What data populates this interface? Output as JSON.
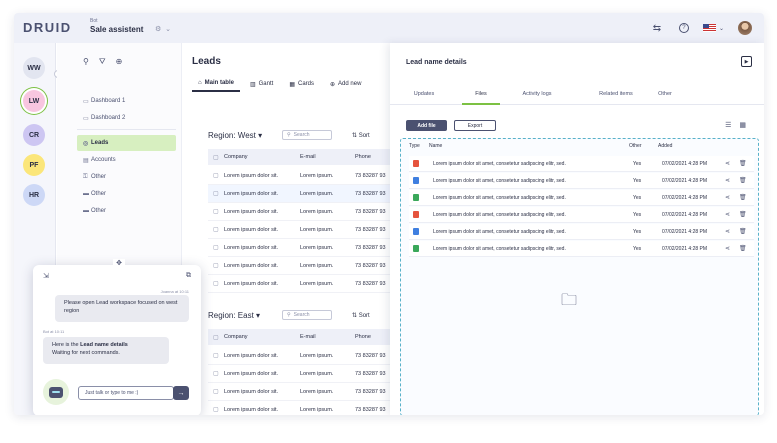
{
  "app": {
    "logo": "DRUID",
    "context_small": "Bot",
    "context_title": "Sale assistent",
    "settings_icon": "gear-icon"
  },
  "topbar": {
    "icons": [
      "handshake-icon",
      "help-icon",
      "flag-us-icon",
      "avatar"
    ]
  },
  "rail": {
    "items": [
      {
        "initials": "WW",
        "color": "#e2e5f0"
      },
      {
        "initials": "LW",
        "color": "#f8c6e0"
      },
      {
        "initials": "CR",
        "color": "#cdc6f2"
      },
      {
        "initials": "PF",
        "color": "#fbe67a"
      },
      {
        "initials": "HR",
        "color": "#cdd8f6"
      }
    ]
  },
  "sidebar": {
    "items": [
      {
        "label": "Dashboard 1",
        "icon": "dashboard-icon"
      },
      {
        "label": "Dashboard 2",
        "icon": "dashboard-icon"
      },
      {
        "label": "Leads",
        "icon": "target-icon",
        "active": true
      },
      {
        "label": "Accounts",
        "icon": "accounts-icon"
      },
      {
        "label": "Other",
        "icon": "key-icon"
      },
      {
        "label": "Other",
        "icon": "folder-icon"
      },
      {
        "label": "Other",
        "icon": "folder-icon"
      }
    ]
  },
  "leads": {
    "title": "Leads",
    "tabs": [
      "Main table",
      "Gantt",
      "Cards",
      "Add new"
    ],
    "search_placeholder": "Search",
    "sort_label": "Sort",
    "columns": [
      "Company",
      "E-mail",
      "Phone"
    ],
    "regions": [
      {
        "title": "Region: West",
        "rows": [
          [
            "Lorem ipsum dolor sit.",
            "Lorem ipsum.",
            "73 83287 93"
          ],
          [
            "Lorem ipsum dolor sit.",
            "Lorem ipsum.",
            "73 83287 93"
          ],
          [
            "Lorem ipsum dolor sit.",
            "Lorem ipsum.",
            "73 83287 93"
          ],
          [
            "Lorem ipsum dolor sit.",
            "Lorem ipsum.",
            "73 83287 93"
          ],
          [
            "Lorem ipsum dolor sit.",
            "Lorem ipsum.",
            "73 83287 93"
          ],
          [
            "Lorem ipsum dolor sit.",
            "Lorem ipsum.",
            "73 83287 93"
          ],
          [
            "Lorem ipsum dolor sit.",
            "Lorem ipsum.",
            "73 83287 93"
          ]
        ]
      },
      {
        "title": "Region: East",
        "rows": [
          [
            "Lorem ipsum dolor sit.",
            "Lorem ipsum.",
            "73 83287 93"
          ],
          [
            "Lorem ipsum dolor sit.",
            "Lorem ipsum.",
            "73 83287 93"
          ],
          [
            "Lorem ipsum dolor sit.",
            "Lorem ipsum.",
            "73 83287 93"
          ],
          [
            "Lorem ipsum dolor sit.",
            "Lorem ipsum.",
            "73 83287 93"
          ]
        ]
      }
    ]
  },
  "details": {
    "title": "Lead name details",
    "tabs": [
      "Updates",
      "Files",
      "Activity logs",
      "Related items",
      "Other"
    ],
    "active_tab": "Files",
    "add_file": "Add file",
    "export": "Export",
    "columns": {
      "type": "Type",
      "name": "Name",
      "other": "Other",
      "added": "Added"
    },
    "files": [
      {
        "type": "pdf",
        "color": "#e5533d",
        "name": "Lorem ipsum dolor sit amet, consetetur sadipscing elitr, sed.",
        "other": "Yes",
        "added": "07/02/2021 4:28 PM"
      },
      {
        "type": "doc",
        "color": "#3f7fe0",
        "name": "Lorem ipsum dolor sit amet, consetetur sadipscing elitr, sed.",
        "other": "Yes",
        "added": "07/02/2021 4:28 PM"
      },
      {
        "type": "xls",
        "color": "#3aa85a",
        "name": "Lorem ipsum dolor sit amet, consetetur sadipscing elitr, sed.",
        "other": "Yes",
        "added": "07/02/2021 4:28 PM"
      },
      {
        "type": "pdf",
        "color": "#e5533d",
        "name": "Lorem ipsum dolor sit amet, consetetur sadipscing elitr, sed.",
        "other": "Yes",
        "added": "07/02/2021 4:28 PM"
      },
      {
        "type": "doc",
        "color": "#3f7fe0",
        "name": "Lorem ipsum dolor sit amet, consetetur sadipscing elitr, sed.",
        "other": "Yes",
        "added": "07/02/2021 4:28 PM"
      },
      {
        "type": "xls",
        "color": "#3aa85a",
        "name": "Lorem ipsum dolor sit amet, consetetur sadipscing elitr, sed.",
        "other": "Yes",
        "added": "07/02/2021 4:28 PM"
      }
    ]
  },
  "chat": {
    "user_meta": "Joanna at 10:11",
    "user_message": "Please open Lead workspace focused on west region",
    "bot_meta": "Bot at 10:11",
    "bot_prefix": "Here is the ",
    "bot_bold": "Lead name details",
    "bot_line2": "Waiting for next commands.",
    "input_placeholder": "Just talk or type to me :)"
  }
}
